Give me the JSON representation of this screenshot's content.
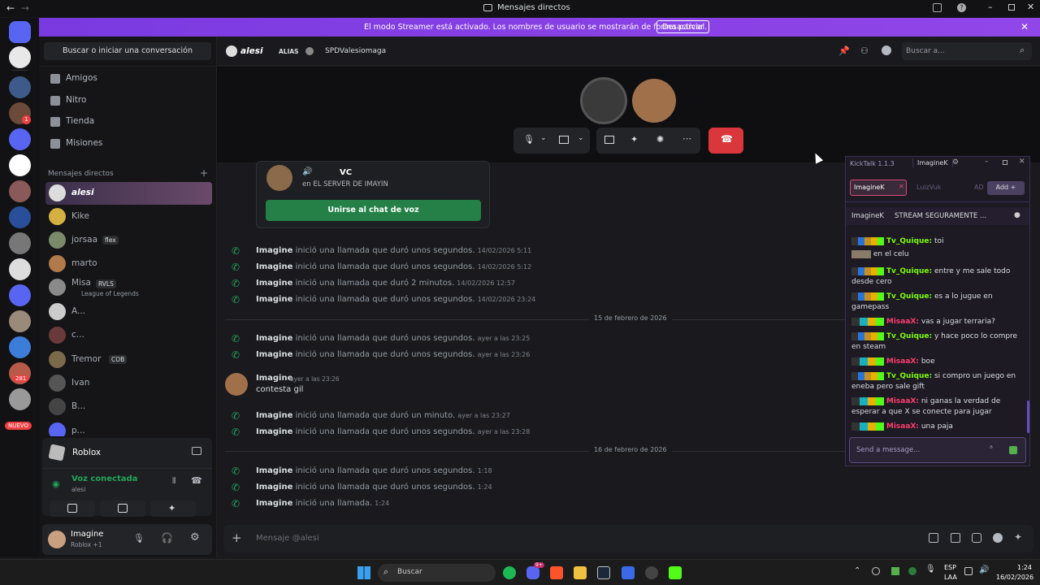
{
  "window": {
    "title": "Mensajes directos"
  },
  "streamer_bar": {
    "text": "El modo Streamer está activado. Los nombres de usuario se mostrarán de forma parcial.",
    "button": "Desactivar"
  },
  "guild_badges": {
    "ping": "1",
    "count": "281",
    "new": "NUEVO"
  },
  "sidebar": {
    "search": "Buscar o iniciar una conversación",
    "nav": [
      "Amigos",
      "Nitro",
      "Tienda",
      "Misiones"
    ],
    "dm_header": "Mensajes directos",
    "dms": [
      {
        "name": "alesi",
        "tag": "",
        "sub": ""
      },
      {
        "name": "Kike",
        "tag": "",
        "sub": ""
      },
      {
        "name": "jorsaa",
        "tag": "flex",
        "sub": ""
      },
      {
        "name": "marto",
        "tag": "",
        "sub": ""
      },
      {
        "name": "Misa",
        "tag": "RVLS",
        "sub": "League of Legends"
      },
      {
        "name": "A...",
        "tag": "",
        "sub": ""
      },
      {
        "name": "c...",
        "tag": "",
        "sub": ""
      },
      {
        "name": "Tremor",
        "tag": "COB",
        "sub": ""
      },
      {
        "name": "Ivan",
        "tag": "",
        "sub": ""
      },
      {
        "name": "B...",
        "tag": "",
        "sub": ""
      },
      {
        "name": "p...",
        "tag": "",
        "sub": ""
      }
    ]
  },
  "activity": {
    "name": "Roblox"
  },
  "voice": {
    "status": "Voz conectada",
    "user": "alesi"
  },
  "user": {
    "name": "Imagine",
    "status": "Roblox +1"
  },
  "header": {
    "name": "alesi",
    "alias_label": "ALIAS",
    "alias": "SPDValesiomaga",
    "search_placeholder": "Buscar a..."
  },
  "invite": {
    "channel": "VC",
    "server": "en EL SERVER DE IMAYIN",
    "button": "Unirse al chat de voz"
  },
  "messages": [
    {
      "type": "call",
      "user": "Imagine",
      "text": "inició una llamada que duró unos segundos.",
      "time": "14/02/2026 5:11"
    },
    {
      "type": "call",
      "user": "Imagine",
      "text": "inició una llamada que duró unos segundos.",
      "time": "14/02/2026 5:12"
    },
    {
      "type": "call",
      "user": "Imagine",
      "text": "inició una llamada que duró 2 minutos.",
      "time": "14/02/2026 12:57"
    },
    {
      "type": "call",
      "user": "Imagine",
      "text": "inició una llamada que duró unos segundos.",
      "time": "14/02/2026 23:24"
    },
    {
      "type": "divider",
      "text": "15 de febrero de 2026"
    },
    {
      "type": "call",
      "user": "Imagine",
      "text": "inició una llamada que duró unos segundos.",
      "time": "ayer a las 23:25"
    },
    {
      "type": "call",
      "user": "Imagine",
      "text": "inició una llamada que duró unos segundos.",
      "time": "ayer a las 23:26"
    },
    {
      "type": "msg",
      "user": "Imagine",
      "time": "ayer a las 23:26",
      "text": "contesta gil"
    },
    {
      "type": "call",
      "user": "Imagine",
      "text": "inició una llamada que duró un minuto.",
      "time": "ayer a las 23:27"
    },
    {
      "type": "call",
      "user": "Imagine",
      "text": "inició una llamada que duró unos segundos.",
      "time": "ayer a las 23:28"
    },
    {
      "type": "divider",
      "text": "16 de febrero de 2026"
    },
    {
      "type": "call",
      "user": "Imagine",
      "text": "inició una llamada que duró unos segundos.",
      "time": "1:18"
    },
    {
      "type": "call",
      "user": "Imagine",
      "text": "inició una llamada que duró unos segundos.",
      "time": "1:24"
    },
    {
      "type": "call",
      "user": "Imagine",
      "text": "inició una llamada.",
      "time": "1:24"
    }
  ],
  "composer": {
    "placeholder": "Mensaje @alesi"
  },
  "kicktalk": {
    "title": "KickTalk 1.1.3",
    "tab": "ImagineK",
    "chip1": "ImagineK",
    "chip2": "LuizVuk",
    "chip3": "AD",
    "add": "Add",
    "stream_user": "ImagineK",
    "stream_title": "STREAM SEGURAMENTE ...",
    "send_placeholder": "Send a message...",
    "chat": [
      {
        "user": "Tv_Quique:",
        "color": "#7cfc00",
        "text": "toi"
      },
      {
        "user": "",
        "color": "",
        "text": "en el celu"
      },
      {
        "user": "Tv_Quique:",
        "color": "#7cfc00",
        "text": "entre y me sale todo desde cero"
      },
      {
        "user": "Tv_Quique:",
        "color": "#7cfc00",
        "text": "es a lo jugue en gamepass"
      },
      {
        "user": "MisaaX:",
        "color": "#ff3d6e",
        "text": "vas a jugar terraria?"
      },
      {
        "user": "Tv_Quique:",
        "color": "#7cfc00",
        "text": "y hace poco lo compre en steam"
      },
      {
        "user": "MisaaX:",
        "color": "#ff3d6e",
        "text": "boe"
      },
      {
        "user": "Tv_Quique:",
        "color": "#7cfc00",
        "text": "si compro un juego en eneba pero sale gift"
      },
      {
        "user": "MisaaX:",
        "color": "#ff3d6e",
        "text": "ni ganas la verdad de esperar a que X se conecte para jugar"
      },
      {
        "user": "MisaaX:",
        "color": "#ff3d6e",
        "text": "una paja"
      }
    ]
  },
  "taskbar": {
    "search": "Buscar",
    "lang1": "ESP",
    "lang2": "LAA",
    "time": "1:24",
    "date": "16/02/2026",
    "badge": "9+"
  }
}
